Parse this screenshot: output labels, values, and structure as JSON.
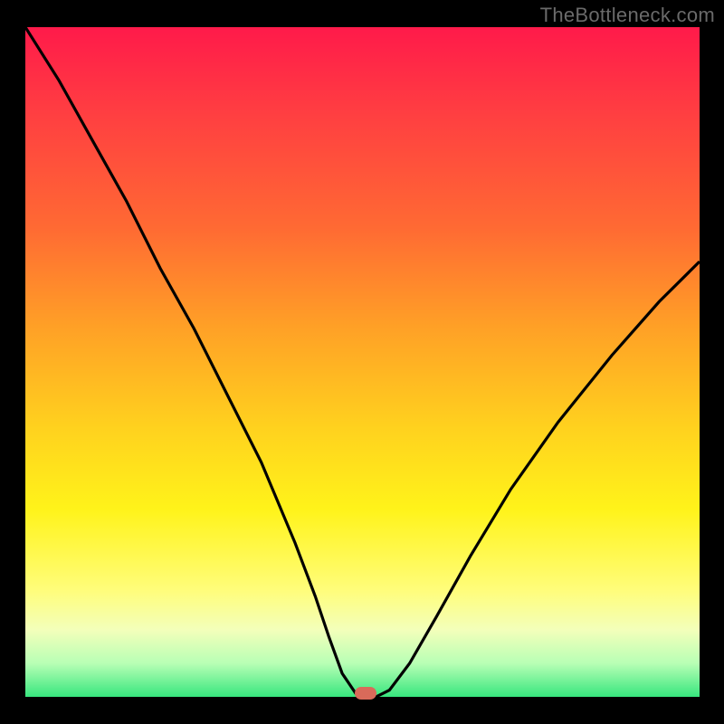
{
  "watermark": "TheBottleneck.com",
  "chart_data": {
    "type": "line",
    "title": "",
    "xlabel": "",
    "ylabel": "",
    "xlim": [
      0,
      1
    ],
    "ylim": [
      0,
      1
    ],
    "grid": false,
    "legend": false,
    "background": "red-to-green vertical gradient",
    "series": [
      {
        "name": "bottleneck-curve",
        "color": "#000000",
        "x": [
          0.0,
          0.05,
          0.1,
          0.15,
          0.2,
          0.25,
          0.3,
          0.35,
          0.4,
          0.43,
          0.45,
          0.47,
          0.49,
          0.495,
          0.5,
          0.52,
          0.54,
          0.57,
          0.61,
          0.66,
          0.72,
          0.79,
          0.87,
          0.94,
          1.0
        ],
        "y": [
          1.0,
          0.92,
          0.83,
          0.74,
          0.64,
          0.55,
          0.45,
          0.35,
          0.23,
          0.15,
          0.09,
          0.035,
          0.005,
          0.001,
          0.0,
          0.0,
          0.01,
          0.05,
          0.12,
          0.21,
          0.31,
          0.41,
          0.51,
          0.59,
          0.65
        ]
      }
    ],
    "marker": {
      "x": 0.505,
      "y": 0.006,
      "color": "#d96a5a"
    }
  },
  "colors": {
    "frame": "#000000",
    "curve": "#000000",
    "marker": "#d96a5a",
    "watermark": "#6a6a6a"
  }
}
